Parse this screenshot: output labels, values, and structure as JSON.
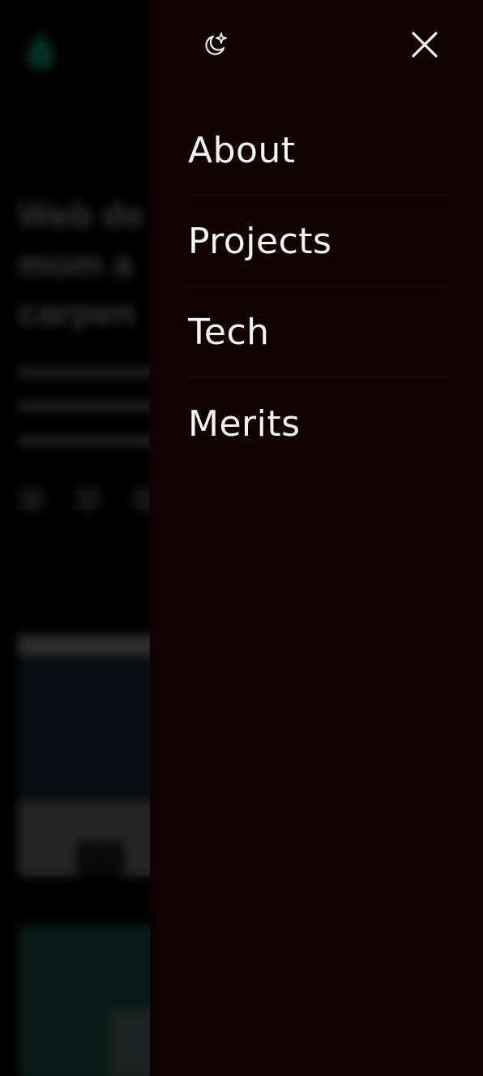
{
  "page": {
    "backdrop": {
      "heading": "Web de\nmom a\ncarpen",
      "logo_color": "#0d5c48"
    },
    "drawer": {
      "background": "#100002",
      "theme_toggle_icon": "moon-stars-icon",
      "close_icon": "close-icon",
      "menu": [
        {
          "label": "About"
        },
        {
          "label": "Projects"
        },
        {
          "label": "Tech"
        },
        {
          "label": "Merits"
        }
      ]
    }
  }
}
